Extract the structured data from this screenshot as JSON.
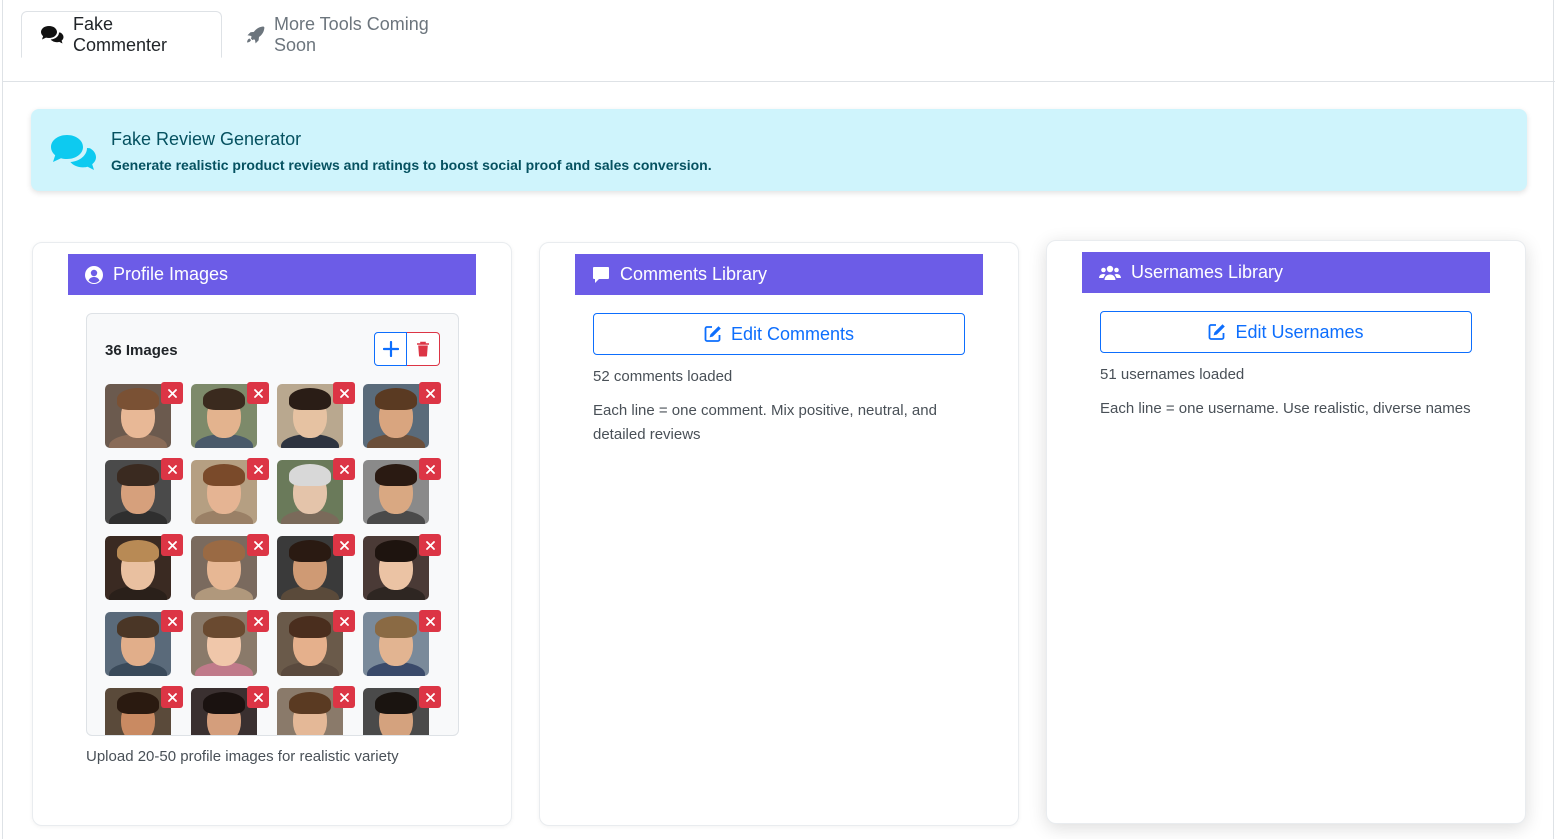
{
  "tabs": [
    {
      "label": "Fake Commenter",
      "icon": "comments-icon",
      "active": true
    },
    {
      "label": "More Tools Coming Soon",
      "icon": "rocket-icon",
      "active": false
    }
  ],
  "alert": {
    "title": "Fake Review Generator",
    "text": "Generate realistic product reviews and ratings to boost social proof and sales conversion.",
    "icon": "comments-icon"
  },
  "profile_card": {
    "header": "Profile Images",
    "count_label": "36 Images",
    "help": "Upload 20-50 profile images for realistic variety",
    "add_icon": "plus-icon",
    "delete_icon": "trash-icon"
  },
  "comments_card": {
    "header": "Comments Library",
    "button": "Edit Comments",
    "loaded": "52 comments loaded",
    "help": "Each line = one comment. Mix positive, neutral, and detailed reviews"
  },
  "usernames_card": {
    "header": "Usernames Library",
    "button": "Edit Usernames",
    "loaded": "51 usernames loaded",
    "help": "Each line = one username. Use realistic, diverse names"
  },
  "colors": {
    "header_bg": "#6c5ce7",
    "primary": "#0d6efd",
    "danger": "#dc3545",
    "alert_bg": "#cff4fc",
    "alert_text": "#055160"
  }
}
